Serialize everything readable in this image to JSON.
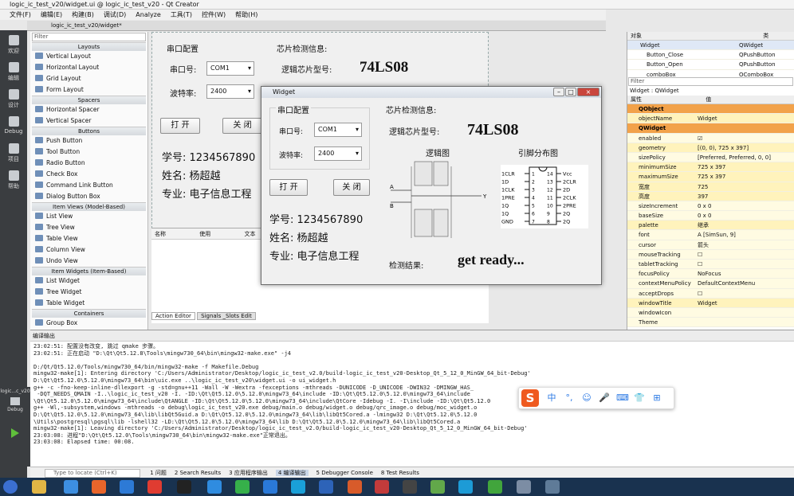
{
  "window": {
    "title": "logic_ic_test_v20/widget.ui @ logic_ic_test_v20 - Qt Creator"
  },
  "menu": [
    "文件(F)",
    "编辑(E)",
    "构建(B)",
    "调试(D)",
    "Analyze",
    "工具(T)",
    "控件(W)",
    "帮助(H)"
  ],
  "modes": [
    "欢迎",
    "编辑",
    "设计",
    "Debug",
    "项目",
    "帮助"
  ],
  "editor_tab": "logic_ic_test_v20/widget*",
  "widgetbox": {
    "filter": "Filter",
    "sections": [
      {
        "title": "Layouts",
        "items": [
          "Vertical Layout",
          "Horizontal Layout",
          "Grid Layout",
          "Form Layout"
        ]
      },
      {
        "title": "Spacers",
        "items": [
          "Horizontal Spacer",
          "Vertical Spacer"
        ]
      },
      {
        "title": "Buttons",
        "items": [
          "Push Button",
          "Tool Button",
          "Radio Button",
          "Check Box",
          "Command Link Button",
          "Dialog Button Box"
        ]
      },
      {
        "title": "Item Views (Model-Based)",
        "items": [
          "List View",
          "Tree View",
          "Table View",
          "Column View",
          "Undo View"
        ]
      },
      {
        "title": "Item Widgets (Item-Based)",
        "items": [
          "List Widget",
          "Tree Widget",
          "Table Widget"
        ]
      },
      {
        "title": "Containers",
        "items": [
          "Group Box"
        ]
      }
    ]
  },
  "form": {
    "serial_group": "串口配置",
    "port_label": "串口号:",
    "port_value": "COM1",
    "baud_label": "波特率:",
    "baud_value": "2400",
    "chip_info": "芯片检测信息:",
    "chip_model_label": "逻辑芯片型号:",
    "chip_model": "74LS08",
    "open_btn": "打 开",
    "close_btn": "关 闭",
    "student_id": "学号: 1234567890",
    "name": "姓名: 杨超越",
    "major": "专业: 电子信息工程"
  },
  "action_editor": {
    "col1": "名称",
    "col2": "使用",
    "col3": "文本",
    "tab1": "Action Editor",
    "tab2": "Signals _Slots Edit"
  },
  "object_panel": {
    "header_obj": "对象",
    "header_cls": "类",
    "rows": [
      [
        "Widget",
        "QWidget"
      ],
      [
        "Button_Close",
        "QPushButton"
      ],
      [
        "Button_Open",
        "QPushButton"
      ],
      [
        "comboBox",
        "QComboBox"
      ]
    ]
  },
  "property_panel": {
    "filter": "Filter",
    "context": "Widget : QWidget",
    "header_prop": "属性",
    "header_val": "值",
    "rows": [
      {
        "k": "QObject",
        "v": "",
        "t": "sec"
      },
      {
        "k": "objectName",
        "v": "Widget",
        "t": "y"
      },
      {
        "k": "QWidget",
        "v": "",
        "t": "sec"
      },
      {
        "k": "enabled",
        "v": "☑",
        "t": "w"
      },
      {
        "k": "geometry",
        "v": "[(0, 0), 725 x 397]",
        "t": "y"
      },
      {
        "k": "sizePolicy",
        "v": "[Preferred, Preferred, 0, 0]",
        "t": "w"
      },
      {
        "k": "minimumSize",
        "v": "725 x 397",
        "t": "y"
      },
      {
        "k": "maximumSize",
        "v": "725 x 397",
        "t": "y"
      },
      {
        "k": "宽度",
        "v": "725",
        "t": "y"
      },
      {
        "k": "高度",
        "v": "397",
        "t": "y"
      },
      {
        "k": "sizeIncrement",
        "v": "0 x 0",
        "t": "w"
      },
      {
        "k": "baseSize",
        "v": "0 x 0",
        "t": "w"
      },
      {
        "k": "palette",
        "v": "继承",
        "t": "y"
      },
      {
        "k": "font",
        "v": "A [SimSun, 9]",
        "t": "w"
      },
      {
        "k": "cursor",
        "v": "箭头",
        "t": "w"
      },
      {
        "k": "mouseTracking",
        "v": "☐",
        "t": "w"
      },
      {
        "k": "tabletTracking",
        "v": "☐",
        "t": "w"
      },
      {
        "k": "focusPolicy",
        "v": "NoFocus",
        "t": "w"
      },
      {
        "k": "contextMenuPolicy",
        "v": "DefaultContextMenu",
        "t": "w"
      },
      {
        "k": "acceptDrops",
        "v": "☐",
        "t": "w"
      },
      {
        "k": "windowTitle",
        "v": "Widget",
        "t": "y"
      },
      {
        "k": "windowIcon",
        "v": "",
        "t": "w"
      },
      {
        "k": "Theme",
        "v": "",
        "t": "w"
      }
    ]
  },
  "output": {
    "title": "编译输出",
    "lines": [
      "23:02:51: 配置没有改变, 跳过 qmake 步骤。",
      "23:02:51: 正在启动 \"D:\\Qt\\Qt5.12.8\\Tools\\mingw730_64\\bin\\mingw32-make.exe\" -j4",
      "",
      "D:/Qt/Qt5.12.0/Tools/mingw730_64/bin/mingw32-make -f Makefile.Debug",
      "mingw32-make[1]: Entering directory 'C:/Users/Administrator/Desktop/logic_ic_test_v2.0/build-logic_ic_test_v20-Desktop_Qt_5_12_0_MinGW_64_bit-Debug'",
      "D:\\Qt\\Qt5.12.0\\5.12.0\\mingw73_64\\bin\\uic.exe ..\\logic_ic_test_v20\\widget.ui -o ui_widget.h",
      "g++ -c -fno-keep-inline-dllexport -g -std=gnu++11 -Wall -W -Wextra -fexceptions -mthreads -DUNICODE -D_UNICODE -DWIN32 -DMINGW_HAS_",
      " -DQT_NEEDS_QMAIN -I..\\logic_ic_test_v20 -I. -ID:\\Qt\\Qt5.12.0\\5.12.0\\mingw73_64\\include -ID:\\Qt\\Qt5.12.0\\5.12.0\\mingw73_64\\include",
      "\\Qt\\Qt5.12.0\\5.12.0\\mingw73_64\\include\\QtANGLE -ID:\\Qt\\Qt5.12.0\\5.12.0\\mingw73_64\\include\\QtCore -Idebug -I. -I\\include -ID:\\Qt\\Qt5.12.0",
      "g++ -Wl,-subsystem,windows -mthreads -o debug\\logic_ic_test_v20.exe debug/main.o debug/widget.o debug/qrc_image.o debug/moc_widget.o",
      "D:\\Qt\\Qt5.12.0\\5.12.0\\mingw73_64\\lib\\libQt5Guid.a D:\\Qt\\Qt5.12.0\\5.12.0\\mingw73_64\\lib\\libQt5Cored.a -lmingw32 D:\\Qt\\Qt5.12.0\\5.12.0",
      "\\Utils\\postgresql\\pgsql\\lib -lshell32 -LD:\\Qt\\Qt5.12.0\\5.12.0\\mingw73_64\\lib D:\\Qt\\Qt5.12.0\\5.12.0\\mingw73_64\\lib\\libQt5Cored.a",
      "mingw32-make[1]: Leaving directory 'C:/Users/Administrator/Desktop/logic_ic_test_v2.0/build-logic_ic_test_v20-Desktop_Qt_5_12_0_MinGW_64_bit-Debug'",
      "23:03:08: 进程\"D:\\Qt\\Qt5.12.0\\Tools\\mingw730_64\\bin\\mingw32-make.exe\"正常退出。",
      "23:03:08: Elapsed time: 00:08."
    ]
  },
  "statusbar": {
    "search_placeholder": "Type to locate (Ctrl+K)",
    "tabs": [
      "1 问题",
      "2 Search Results",
      "3 应用程序输出",
      "4 编译输出",
      "5 Debugger Console",
      "8 Test Results"
    ]
  },
  "run_kit": {
    "label": "logic...c_v20",
    "mode": "Debug"
  },
  "dialog": {
    "title": "Widget",
    "serial_group": "串口配置",
    "port_label": "串口号:",
    "port_value": "COM1",
    "baud_label": "波特率:",
    "baud_value": "2400",
    "open_btn": "打 开",
    "close_btn": "关 闭",
    "student_id": "学号: 1234567890",
    "name": "姓名: 杨超越",
    "major": "专业: 电子信息工程",
    "chip_info": "芯片检测信息:",
    "chip_model_label": "逻辑芯片型号:",
    "chip_model": "74LS08",
    "logic_title": "逻辑图",
    "pin_title": "引脚分布图",
    "result_label": "检测结果:",
    "result": "get ready...",
    "logic_labels": {
      "a": "A",
      "b": "B",
      "y": "Y"
    },
    "pins_left": [
      "1CLR",
      "1D",
      "1CLK",
      "1PRE",
      "1Q",
      "1Q",
      "GND"
    ],
    "pins_right": [
      "Vcc",
      "2CLR",
      "2D",
      "2CLK",
      "2PRE",
      "2Q",
      "2Q"
    ],
    "pin_nums_left": [
      "1",
      "2",
      "3",
      "4",
      "5",
      "6",
      "7"
    ],
    "pin_nums_right": [
      "14",
      "13",
      "12",
      "11",
      "10",
      "9",
      "8"
    ]
  },
  "ime": {
    "logo": "S",
    "items": [
      "中",
      "°,",
      "☺",
      "🎤",
      "⌨",
      "👕",
      "⊞"
    ]
  },
  "colors": {
    "accent_orange": "#f2a24a",
    "mode_bar": "#3a3d40",
    "taskbar": "#19324f"
  }
}
